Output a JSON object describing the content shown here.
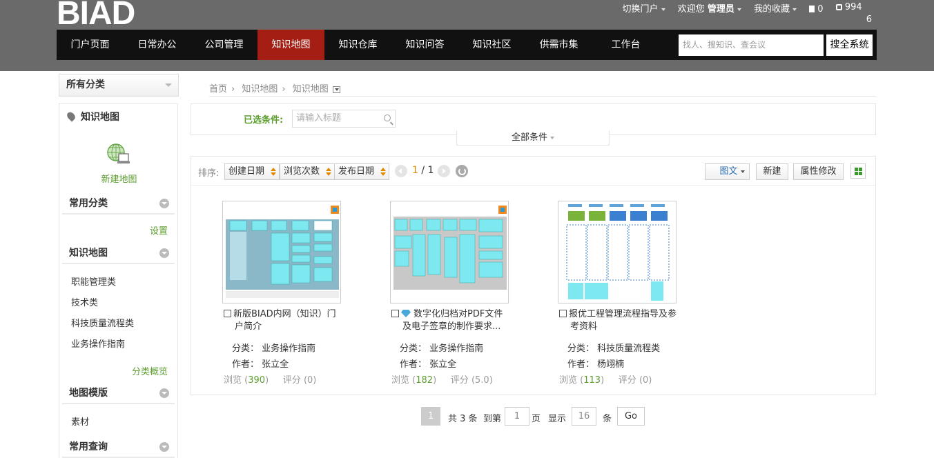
{
  "header": {
    "logo": "BIAD",
    "switch_portal": "切换门户",
    "welcome": "欢迎您",
    "user": "管理员",
    "favorites": "我的收藏",
    "doc_count": "0",
    "edit_count_line1": "994",
    "edit_count_line2": "6"
  },
  "nav": {
    "items": [
      "门户页面",
      "日常办公",
      "公司管理",
      "知识地图",
      "知识仓库",
      "知识问答",
      "知识社区",
      "供需市集",
      "工作台"
    ],
    "active": "知识地图",
    "search_placeholder": "找人、搜知识、查会议",
    "search_button": "搜全系统"
  },
  "sidebar": {
    "all_categories": "所有分类",
    "panel_title": "知识地图",
    "new_map": "新建地图",
    "common_categories": "常用分类",
    "settings": "设置",
    "knowledge_map": "知识地图",
    "map_items": [
      "职能管理类",
      "技术类",
      "科技质量流程类",
      "业务操作指南"
    ],
    "category_overview": "分类概览",
    "map_template": "地图模版",
    "template_items": [
      "素材"
    ],
    "common_queries": "常用查询"
  },
  "breadcrumb": [
    "首页",
    "知识地图",
    "知识地图"
  ],
  "filter": {
    "label": "已选条件:",
    "title_placeholder": "请输入标题",
    "all_conditions": "全部条件"
  },
  "toolbar": {
    "sort_label": "排序:",
    "sort_options": [
      "创建日期",
      "浏览次数",
      "发布日期"
    ],
    "page_current": "1",
    "page_total": "/ 1",
    "view_mode": "图文",
    "new_button": "新建",
    "attr_button": "属性修改"
  },
  "cards": [
    {
      "title_line1": "新版BIAD内网（知识）门",
      "title_line2": "户简介",
      "category_label": "分类：",
      "category": "业务操作指南",
      "author_label": "作者：",
      "author": "张立全",
      "views_label": "浏览",
      "views": "390",
      "rating_label": "评分",
      "rating": "(0)",
      "gem": false
    },
    {
      "title_line1": "数字化归档对PDF文件",
      "title_line2": "及电子签章的制作要求...",
      "category_label": "分类：",
      "category": "业务操作指南",
      "author_label": "作者：",
      "author": "张立全",
      "views_label": "浏览",
      "views": "182",
      "rating_label": "评分",
      "rating": "(5.0)",
      "gem": true
    },
    {
      "title_line1": "报优工程管理流程指导及参",
      "title_line2": "考资料",
      "category_label": "分类：",
      "category": "科技质量流程类",
      "author_label": "作者：",
      "author": "杨翊楠",
      "views_label": "浏览",
      "views": "113",
      "rating_label": "评分",
      "rating": "(0)",
      "gem": false
    }
  ],
  "pager": {
    "current": "1",
    "total_text": "共 3 条",
    "goto_label": "到第",
    "goto_value": "1",
    "page_unit": "页",
    "show_label": "显示",
    "show_value": "16",
    "item_unit": "条",
    "go_button": "Go"
  },
  "colors": {
    "accent_red": "#a41e13",
    "accent_green": "#5c9e2e",
    "header_gray": "#6a6a6a"
  }
}
